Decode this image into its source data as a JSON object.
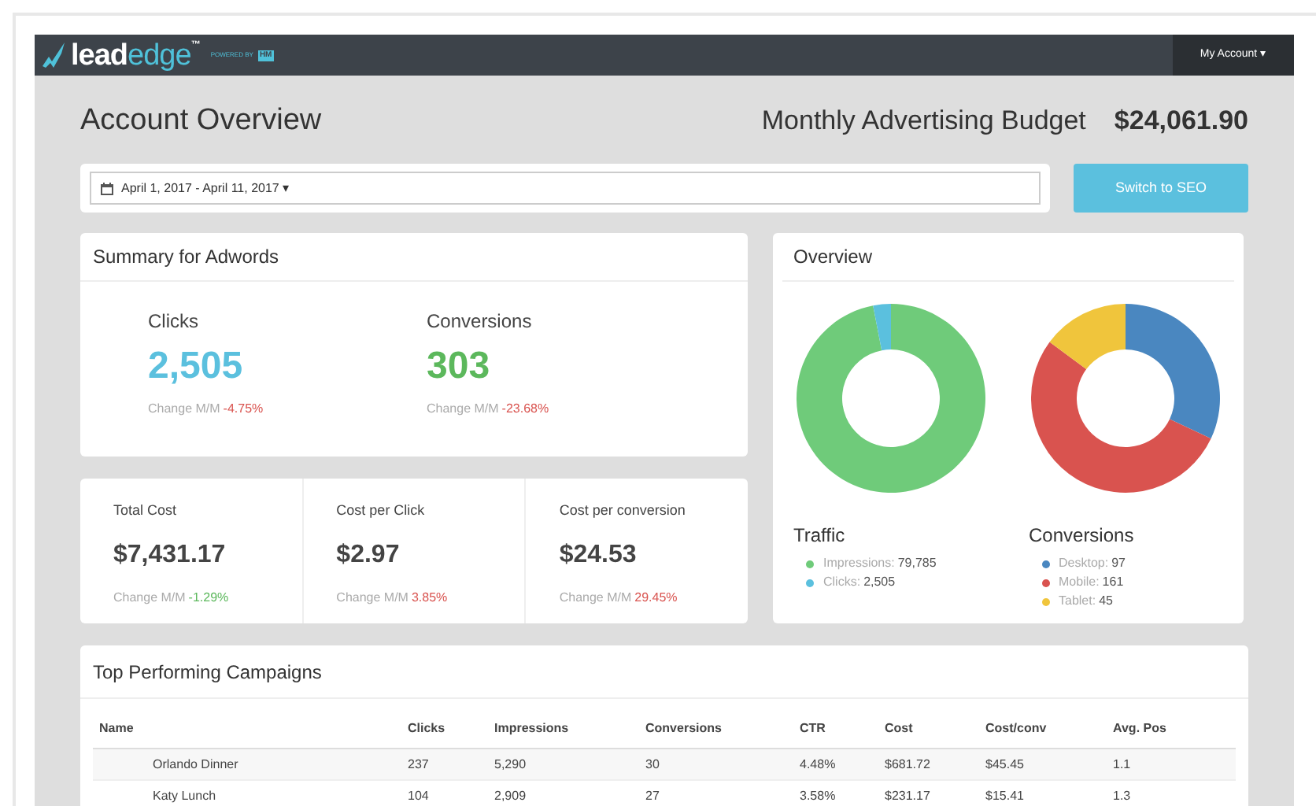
{
  "brand": {
    "part1": "lead",
    "part2": "edge",
    "trademark": "™",
    "powered_by": "POWERED BY",
    "partner": "HM"
  },
  "account_menu": {
    "label": "My Account",
    "caret": "▾"
  },
  "page_title": "Account Overview",
  "budget": {
    "label": "Monthly Advertising Budget",
    "value": "$24,061.90"
  },
  "date_range": {
    "value": "April 1, 2017 - April 11, 2017",
    "caret": "▾"
  },
  "switch_button": "Switch to SEO",
  "summary": {
    "title": "Summary for Adwords",
    "metrics": [
      {
        "label": "Clicks",
        "value": "2,505",
        "color": "#5bc0de",
        "change": {
          "label": "Change M/M",
          "value": "-4.75%",
          "color": "#d9534f"
        }
      },
      {
        "label": "Conversions",
        "value": "303",
        "color": "#5cb85c",
        "change": {
          "label": "Change M/M",
          "value": "-23.68%",
          "color": "#d9534f"
        }
      }
    ]
  },
  "costs": [
    {
      "label": "Total Cost",
      "value": "$7,431.17",
      "change": {
        "label": "Change M/M",
        "value": "-1.29%",
        "color": "#5cb85c"
      }
    },
    {
      "label": "Cost per Click",
      "value": "$2.97",
      "change": {
        "label": "Change M/M",
        "value": "3.85%",
        "color": "#d9534f"
      }
    },
    {
      "label": "Cost per conversion",
      "value": "$24.53",
      "change": {
        "label": "Change M/M",
        "value": "29.45%",
        "color": "#d9534f"
      }
    }
  ],
  "overview": {
    "title": "Overview",
    "charts": [
      {
        "kind": "donut",
        "title": "Traffic",
        "legend": [
          {
            "label": "Impressions:",
            "value": "79,785",
            "color": "#6fcb7a"
          },
          {
            "label": "Clicks:",
            "value": "2,505",
            "color": "#5bc0de"
          }
        ]
      },
      {
        "kind": "donut",
        "title": "Conversions",
        "legend": [
          {
            "label": "Desktop:",
            "value": "97",
            "color": "#4a87c0"
          },
          {
            "label": "Mobile:",
            "value": "161",
            "color": "#d9534f"
          },
          {
            "label": "Tablet:",
            "value": "45",
            "color": "#f0c53c"
          }
        ]
      }
    ]
  },
  "campaigns": {
    "title": "Top Performing Campaigns",
    "columns": [
      "Name",
      "Clicks",
      "Impressions",
      "Conversions",
      "CTR",
      "Cost",
      "Cost/conv",
      "Avg. Pos"
    ],
    "rows": [
      [
        "Orlando Dinner",
        "237",
        "5,290",
        "30",
        "4.48%",
        "$681.72",
        "$45.45",
        "1.1"
      ],
      [
        "Katy Lunch",
        "104",
        "2,909",
        "27",
        "3.58%",
        "$231.17",
        "$15.41",
        "1.3"
      ]
    ]
  }
}
